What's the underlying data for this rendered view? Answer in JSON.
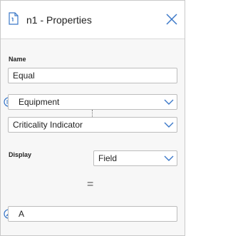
{
  "header": {
    "title": "n1 - Properties",
    "icon": "document-icon",
    "close_icon": "close-icon"
  },
  "name": {
    "label": "Name",
    "value": "Equal"
  },
  "source": {
    "entity": "Equipment",
    "entity_icon": "list-icon",
    "field": "Criticality Indicator"
  },
  "display": {
    "label": "Display",
    "selected": "Field"
  },
  "operator": {
    "symbol": "="
  },
  "value": {
    "text": "A",
    "icon": "pencil-icon"
  },
  "colors": {
    "accent": "#3b78c8",
    "border": "#bdbdbd",
    "background": "#f7f7f7"
  }
}
